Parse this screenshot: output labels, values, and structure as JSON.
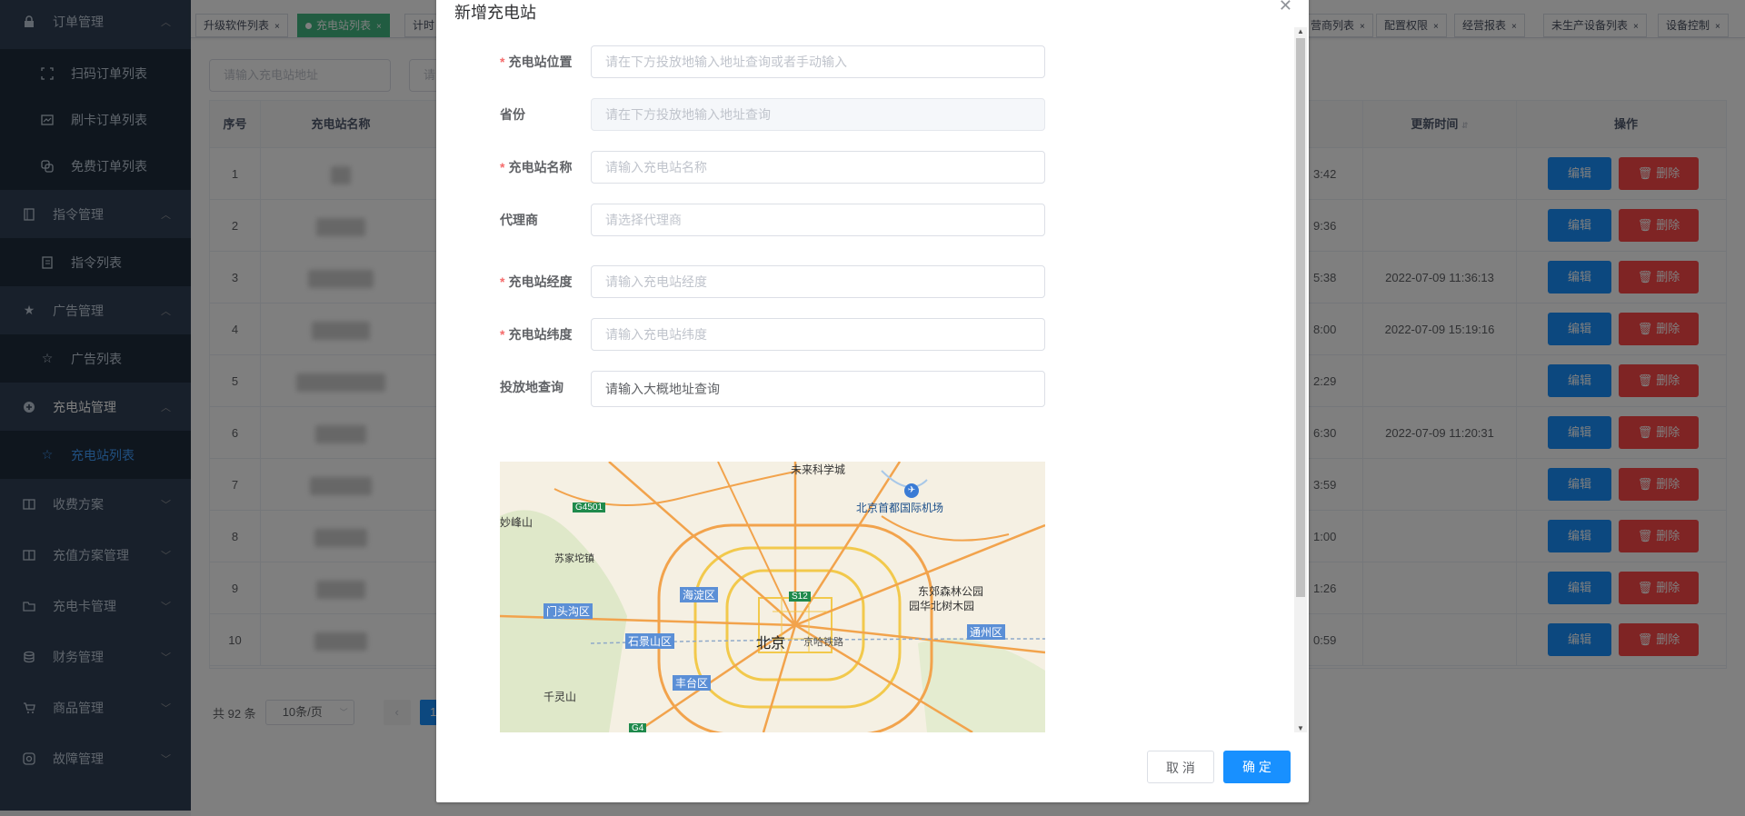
{
  "sidebar": {
    "items": [
      {
        "label": "订单管理",
        "icon": "lock-icon",
        "arrow": "^"
      },
      {
        "label": "扫码订单列表",
        "icon": "scan-icon"
      },
      {
        "label": "刷卡订单列表",
        "icon": "card-icon"
      },
      {
        "label": "免费订单列表",
        "icon": "free-icon"
      },
      {
        "label": "指令管理",
        "icon": "book-icon",
        "arrow": "^"
      },
      {
        "label": "指令列表",
        "icon": "list-icon"
      },
      {
        "label": "广告管理",
        "icon": "star-icon",
        "arrow": "^"
      },
      {
        "label": "广告列表",
        "icon": "star-outline-icon"
      },
      {
        "label": "充电站管理",
        "icon": "plus-circle-icon",
        "arrow": "^"
      },
      {
        "label": "充电站列表",
        "icon": "star-outline-icon"
      },
      {
        "label": "收费方案",
        "icon": "book-open-icon",
        "arrow": "v"
      },
      {
        "label": "充值方案管理",
        "icon": "book-open-icon",
        "arrow": "v"
      },
      {
        "label": "充电卡管理",
        "icon": "folder-icon",
        "arrow": "v"
      },
      {
        "label": "财务管理",
        "icon": "coins-icon",
        "arrow": "v"
      },
      {
        "label": "商品管理",
        "icon": "cart-icon",
        "arrow": "v"
      },
      {
        "label": "故障管理",
        "icon": "fault-icon",
        "arrow": "v"
      }
    ]
  },
  "tags": [
    {
      "label": "升级软件列表"
    },
    {
      "label": "充电站列表",
      "active": true
    },
    {
      "label": "计时"
    },
    {
      "label": "营商列表"
    },
    {
      "label": "配置权限"
    },
    {
      "label": "经营报表"
    },
    {
      "label": "未生产设备列表"
    },
    {
      "label": "设备控制"
    }
  ],
  "search": {
    "address_placeholder": "请输入充电站地址",
    "other_placeholder": "请"
  },
  "table": {
    "headers": {
      "index": "序号",
      "name": "充电站名称",
      "updated": "更新时间",
      "ops": "操作"
    },
    "rows": [
      {
        "index": "1",
        "created_tail": "3:42",
        "updated": ""
      },
      {
        "index": "2",
        "created_tail": "9:36",
        "updated": ""
      },
      {
        "index": "3",
        "created_tail": "5:38",
        "updated": "2022-07-09 11:36:13"
      },
      {
        "index": "4",
        "created_tail": "8:00",
        "updated": "2022-07-09 15:19:16"
      },
      {
        "index": "5",
        "created_tail": "2:29",
        "updated": ""
      },
      {
        "index": "6",
        "created_tail": "6:30",
        "updated": "2022-07-09 11:20:31"
      },
      {
        "index": "7",
        "created_tail": "3:59",
        "updated": ""
      },
      {
        "index": "8",
        "created_tail": "1:00",
        "updated": ""
      },
      {
        "index": "9",
        "created_tail": "1:26",
        "updated": ""
      },
      {
        "index": "10",
        "created_tail": "0:59",
        "updated": ""
      }
    ],
    "edit_label": "编辑",
    "delete_label": "删除"
  },
  "pager": {
    "total": "共 92 条",
    "page_size": "10条/页",
    "current": "1"
  },
  "dialog": {
    "title": "新增充电站",
    "fields": {
      "location": {
        "label": "充电站位置",
        "placeholder": "请在下方投放地输入地址查询或者手动输入"
      },
      "province": {
        "label": "省份",
        "placeholder": "请在下方投放地输入地址查询"
      },
      "name": {
        "label": "充电站名称",
        "placeholder": "请输入充电站名称"
      },
      "agent": {
        "label": "代理商",
        "placeholder": "请选择代理商"
      },
      "lng": {
        "label": "充电站经度",
        "placeholder": "请输入充电站经度"
      },
      "lat": {
        "label": "充电站纬度",
        "placeholder": "请输入充电站纬度"
      },
      "query": {
        "label": "投放地查询",
        "value": "请输入大概地址查询"
      }
    },
    "map": {
      "labels": {
        "future_city": "未来科学城",
        "airport": "北京首都国际机场",
        "g4501": "G4501",
        "miaofeng": "妙峰山",
        "shangzhuang": "苏家坨镇",
        "haidian": "海淀区",
        "s12": "S12",
        "mentougou": "门头沟区",
        "shijingshan": "石景山区",
        "beijing": "北京",
        "jingha": "京哈铁路",
        "tongzhou": "通州区",
        "park": "东郊森林公园",
        "park2": "园华北树木园",
        "fengtai": "丰台区",
        "qianling": "千灵山",
        "g4": "G4"
      }
    },
    "cancel_label": "取 消",
    "ok_label": "确 定"
  },
  "colors": {
    "primary": "#1890ff",
    "danger": "#ff4949",
    "sidebar": "#304156",
    "active_tag": "#42b983"
  }
}
